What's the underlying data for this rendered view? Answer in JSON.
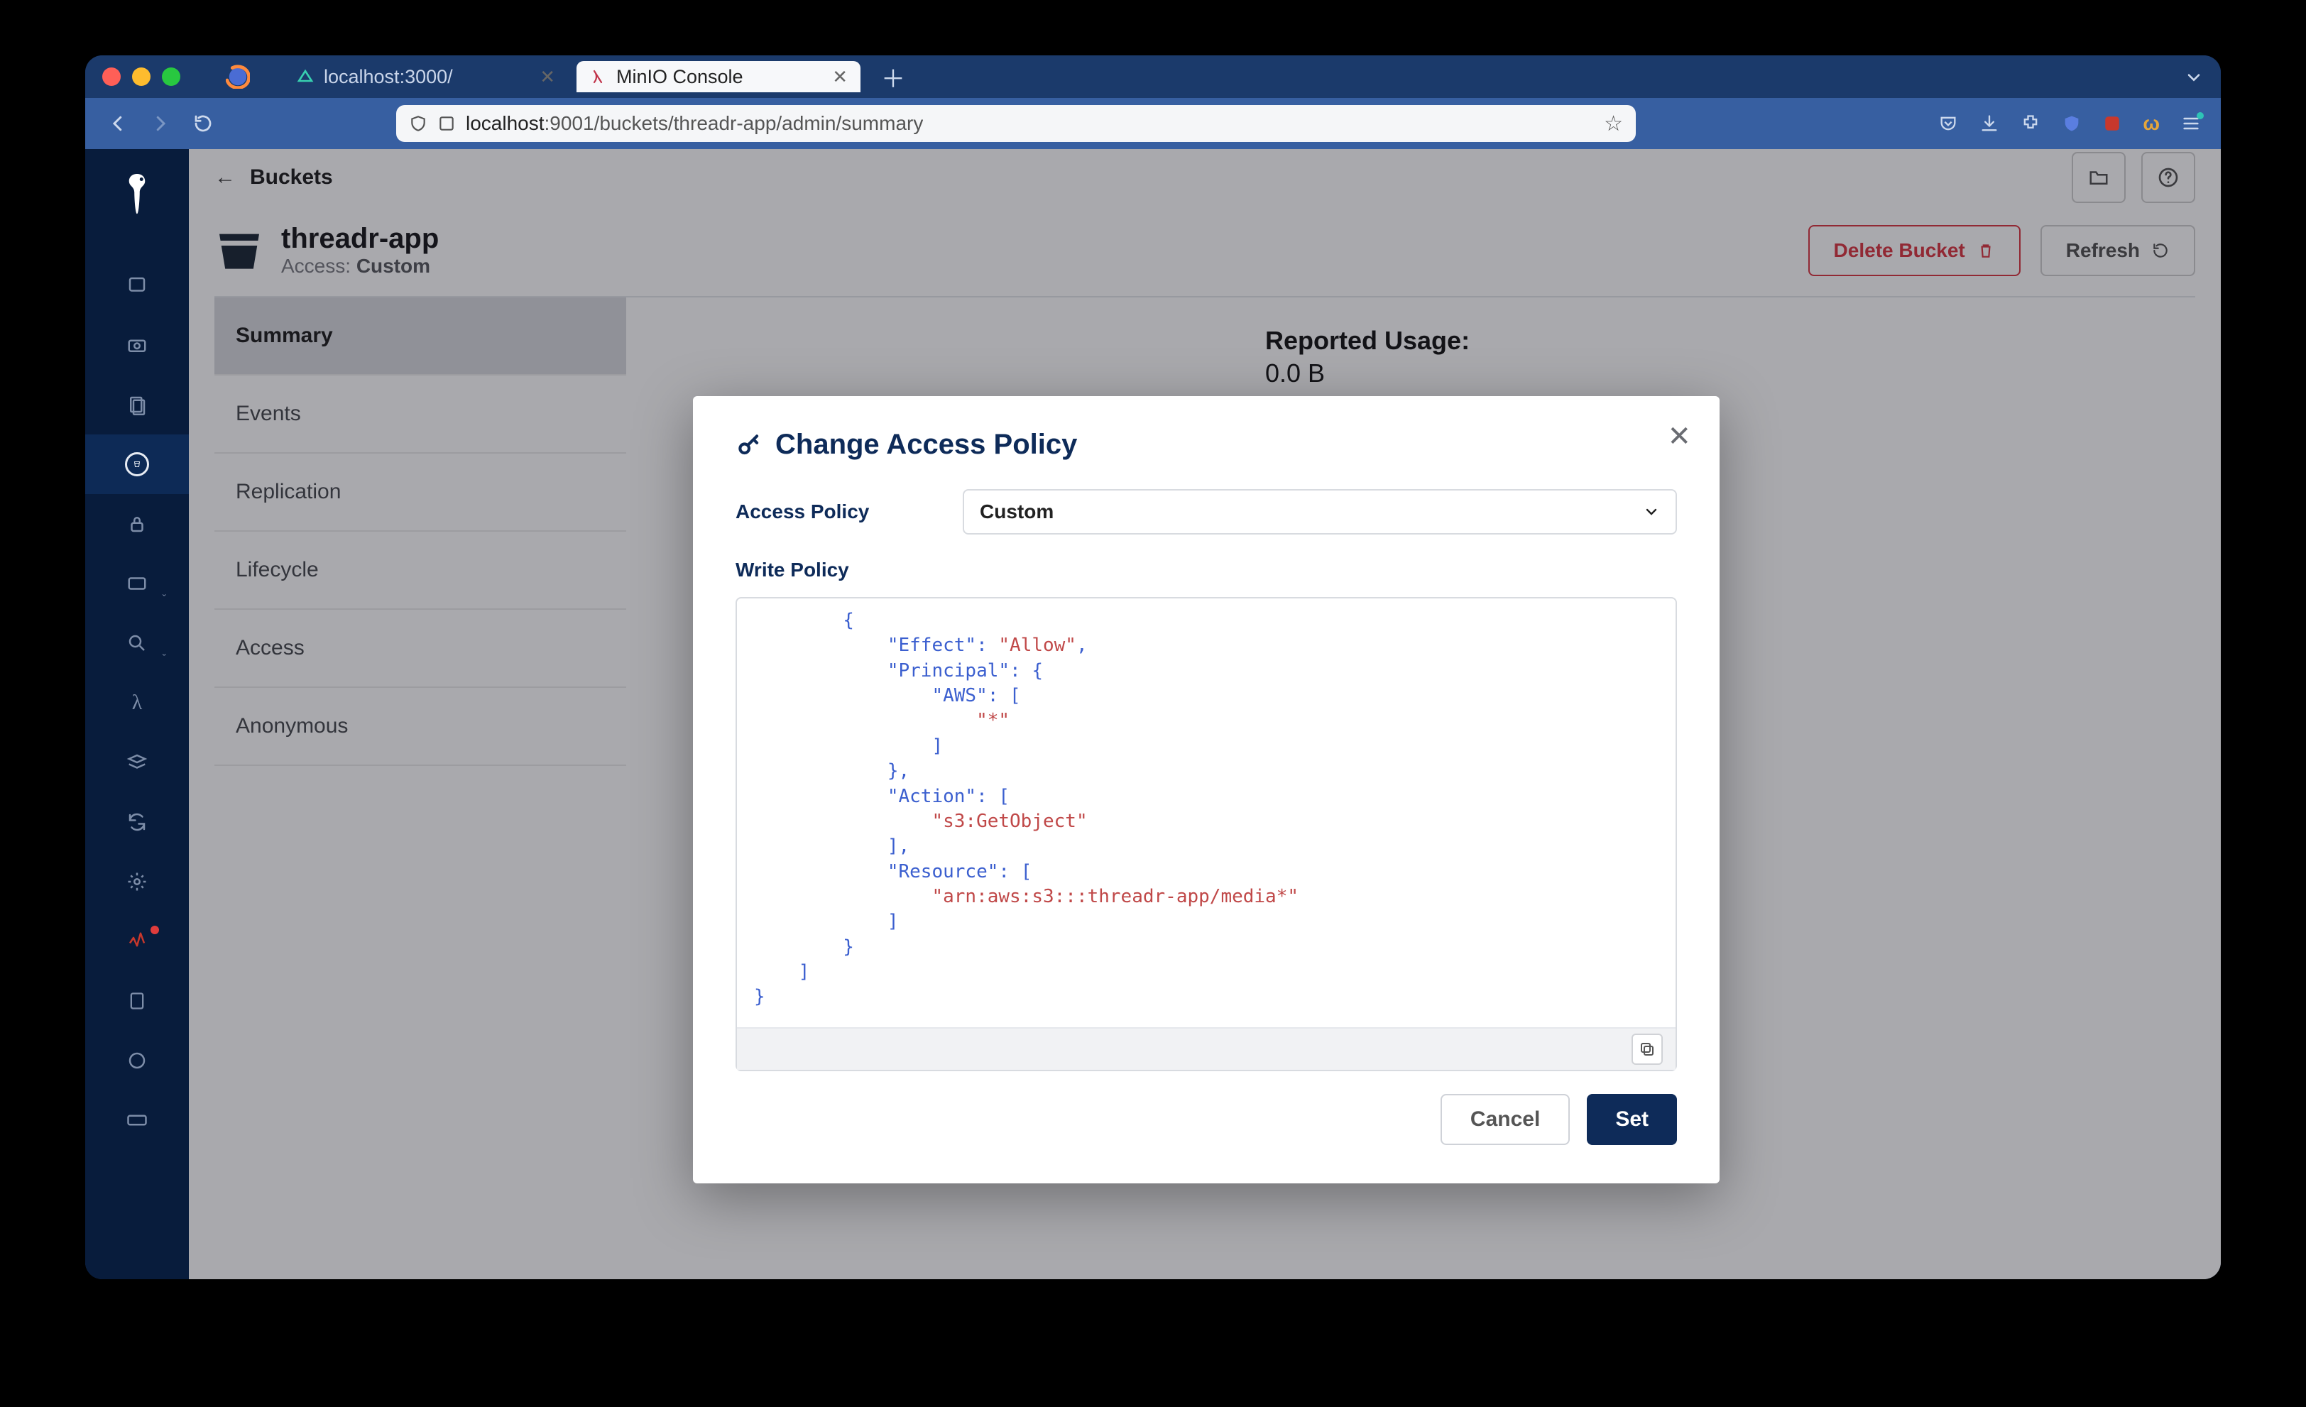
{
  "browser": {
    "tabs": [
      {
        "label": "localhost:3000/",
        "active": false
      },
      {
        "label": "MinIO Console",
        "active": true
      }
    ],
    "url_host": "localhost",
    "url_port_path": ":9001/buckets/threadr-app/admin/summary"
  },
  "breadcrumb": {
    "back_icon": "←",
    "label": "Buckets"
  },
  "bucket": {
    "name": "threadr-app",
    "access_label": "Access:",
    "access_value": "Custom"
  },
  "header_buttons": {
    "delete": "Delete Bucket",
    "refresh": "Refresh"
  },
  "tabs": [
    "Summary",
    "Events",
    "Replication",
    "Lifecycle",
    "Access",
    "Anonymous"
  ],
  "active_tab": "Summary",
  "usage": {
    "title": "Reported Usage:",
    "value": "0.0 B"
  },
  "modal": {
    "title": "Change Access Policy",
    "access_policy_label": "Access Policy",
    "access_policy_value": "Custom",
    "write_policy_label": "Write Policy",
    "policy_json": {
      "open_brace": "{",
      "effect_k": "\"Effect\"",
      "effect_v": "\"Allow\"",
      "principal_k": "\"Principal\"",
      "aws_k": "\"AWS\"",
      "star_v": "\"*\"",
      "action_k": "\"Action\"",
      "action_v": "\"s3:GetObject\"",
      "resource_k": "\"Resource\"",
      "resource_v": "\"arn:aws:s3:::threadr-app/media*\""
    },
    "cancel": "Cancel",
    "set": "Set"
  }
}
